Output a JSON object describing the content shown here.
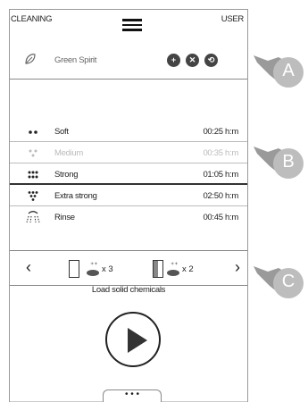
{
  "topbar": {
    "left_label": "CLEANING",
    "right_label": "USER"
  },
  "program": {
    "name": "Green Spirit"
  },
  "list": [
    {
      "label": "Soft",
      "time": "00:25 h:m",
      "state": "normal"
    },
    {
      "label": "Medium",
      "time": "00:35 h:m",
      "state": "dim"
    },
    {
      "label": "Strong",
      "time": "01:05 h:m",
      "state": "normal"
    },
    {
      "label": "Extra strong",
      "time": "02:50 h:m",
      "state": "normal"
    },
    {
      "label": "Rinse",
      "time": "00:45 h:m",
      "state": "normal"
    }
  ],
  "chemicals": {
    "multiplier_1": "x 3",
    "multiplier_2": "x 2",
    "load_text": "Load solid  chemicals"
  },
  "bottom_tab": "• • •",
  "callouts": [
    "A",
    "B",
    "C"
  ],
  "colors": {
    "accent": "#444444",
    "dim_text": "#bbbbbb",
    "callout": "#bdbdbd"
  },
  "icons": [
    "menu-icon",
    "leaf-icon",
    "plus-icon",
    "close-icon",
    "eco-icon",
    "play-icon",
    "chevron-left-icon",
    "chevron-right-icon"
  ]
}
